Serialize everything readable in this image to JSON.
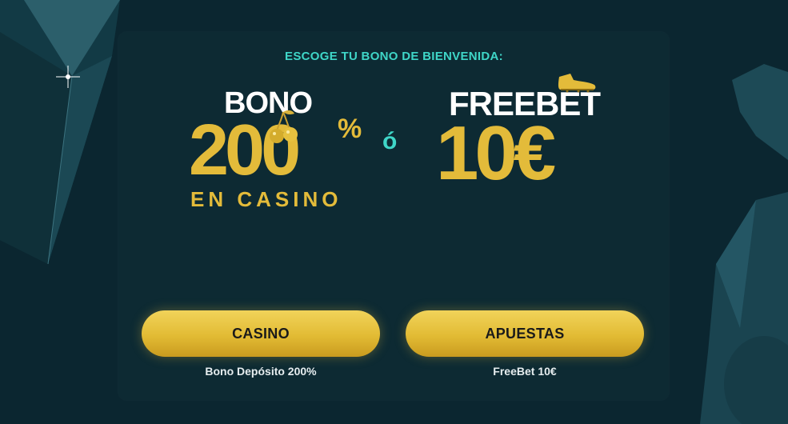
{
  "headline": "ESCOGE TU BONO DE BIENVENIDA:",
  "casino_offer": {
    "prefix": "BONO",
    "amount": "200",
    "percent": "%",
    "suffix": "EN CASINO",
    "icon": "cherries-icon"
  },
  "separator": "ó",
  "bets_offer": {
    "prefix": "FREEBET",
    "amount": "10€",
    "icon": "football-boot-icon"
  },
  "buttons": {
    "casino_label": "CASINO",
    "casino_caption": "Bono Depósito 200%",
    "bets_label": "APUESTAS",
    "bets_caption": "FreeBet 10€"
  },
  "colors": {
    "accent_teal": "#3fd6c8",
    "gold": "#e3bb3a",
    "background": "#0b2630",
    "panel": "#0d2a33"
  }
}
